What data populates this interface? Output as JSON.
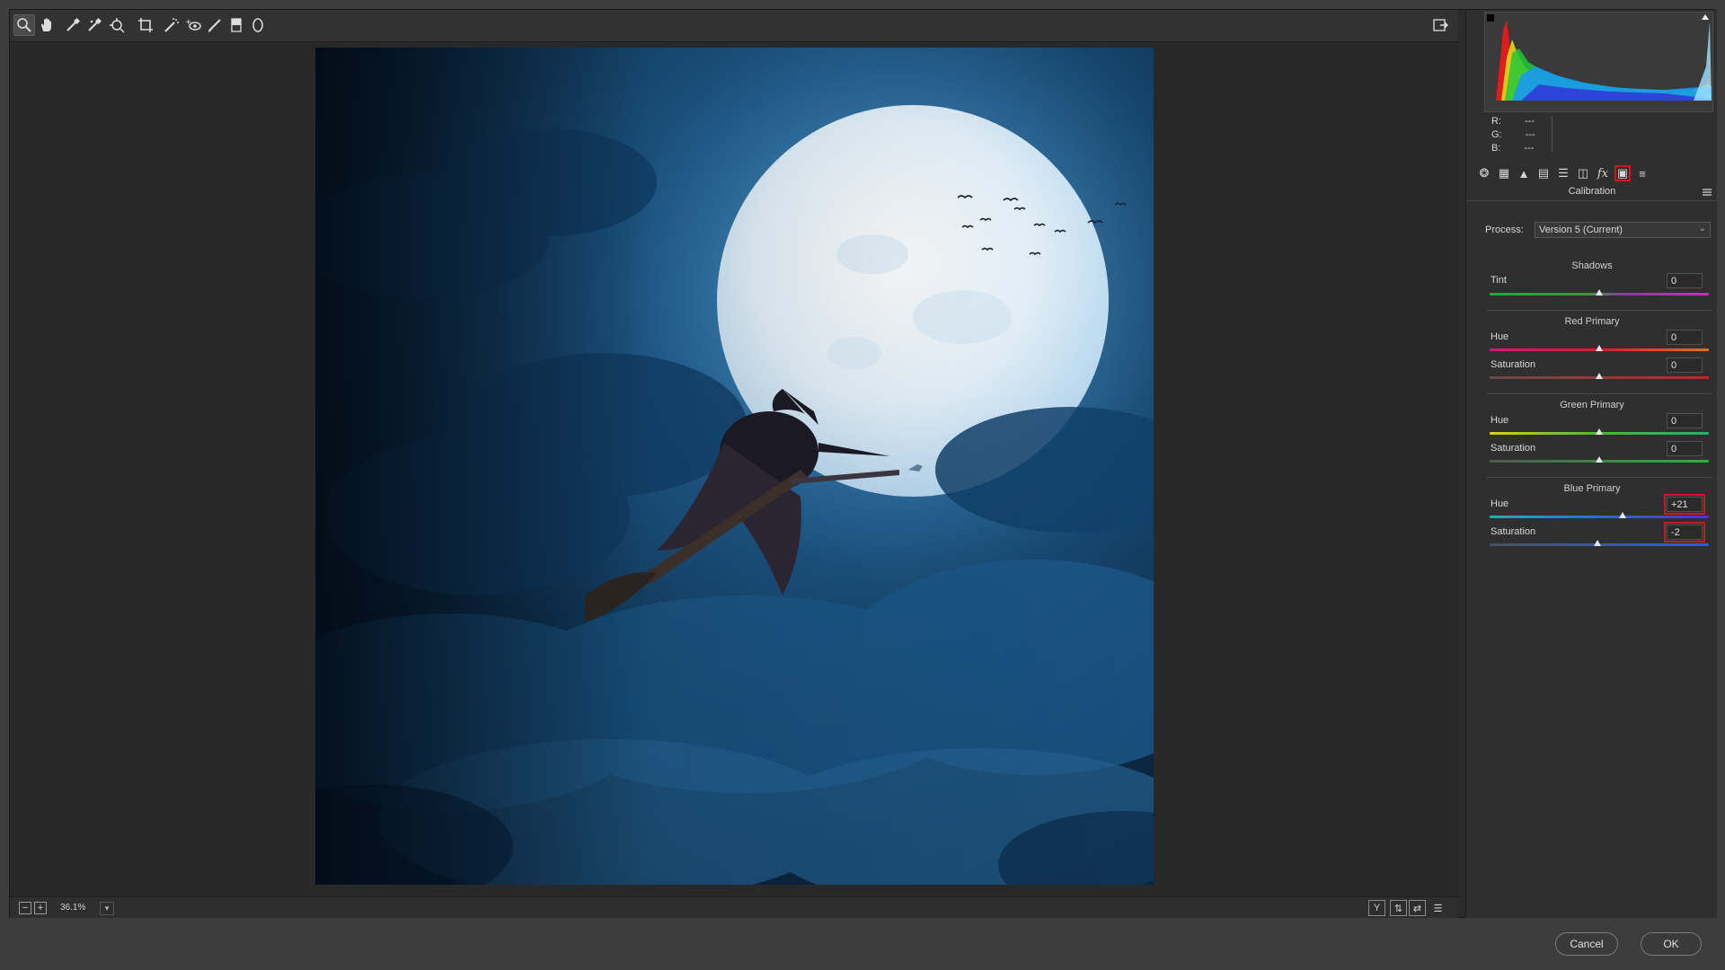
{
  "toolbar": {
    "tools": [
      "zoom-tool",
      "hand-tool",
      "white-balance-tool",
      "color-sampler-tool",
      "targeted-adjustment-tool",
      "crop-tool",
      "spot-removal-tool",
      "red-eye-removal-tool",
      "adjustment-brush-tool",
      "graduated-filter-tool",
      "radial-filter-tool"
    ]
  },
  "status": {
    "zoom": "36.1%",
    "zoom_out": "−",
    "zoom_in": "+"
  },
  "histogram": {
    "readout": [
      {
        "label": "R:",
        "value": "---"
      },
      {
        "label": "G:",
        "value": "---"
      },
      {
        "label": "B:",
        "value": "---"
      }
    ]
  },
  "panel": {
    "title": "Calibration",
    "process_label": "Process:",
    "process_value": "Version 5 (Current)",
    "shadows": {
      "title": "Shadows",
      "tint": {
        "label": "Tint",
        "value": "0",
        "level": 0
      }
    },
    "red_primary": {
      "title": "Red Primary",
      "hue": {
        "label": "Hue",
        "value": "0",
        "level": 0
      },
      "saturation": {
        "label": "Saturation",
        "value": "0",
        "level": 0
      }
    },
    "green_primary": {
      "title": "Green Primary",
      "hue": {
        "label": "Hue",
        "value": "0",
        "level": 0
      },
      "saturation": {
        "label": "Saturation",
        "value": "0",
        "level": 0
      }
    },
    "blue_primary": {
      "title": "Blue Primary",
      "hue": {
        "label": "Hue",
        "value": "+21",
        "level": 21
      },
      "saturation": {
        "label": "Saturation",
        "value": "-2",
        "level": -2
      }
    }
  },
  "footer": {
    "cancel": "Cancel",
    "ok": "OK"
  },
  "colors": {
    "highlight": "#d0161f",
    "background": "#3c3c3c"
  }
}
